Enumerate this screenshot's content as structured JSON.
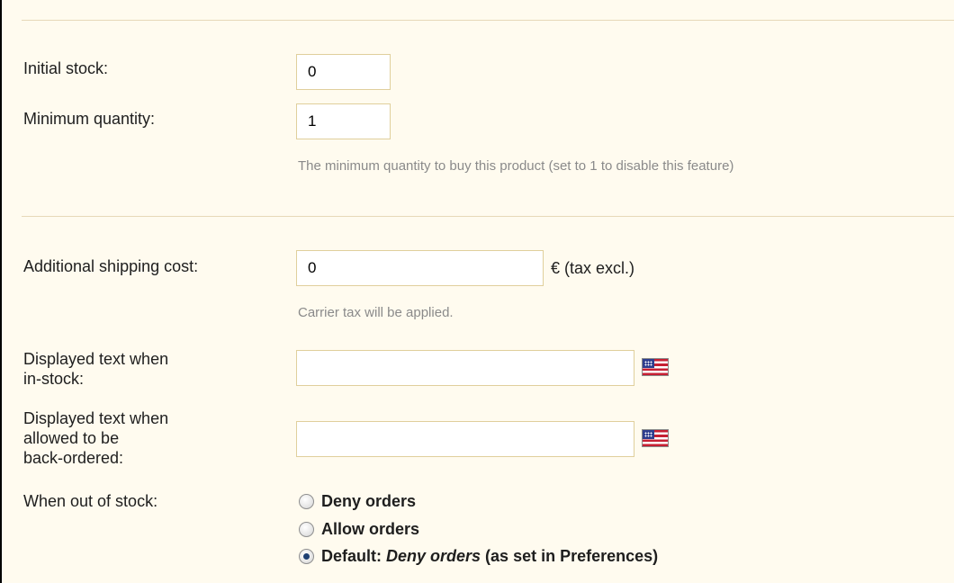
{
  "stock": {
    "initial_stock": {
      "label": "Initial stock:",
      "value": "0"
    },
    "minimum_quantity": {
      "label": "Minimum quantity:",
      "value": "1",
      "hint": "The minimum quantity to buy this product (set to 1 to disable this feature)"
    }
  },
  "shipping": {
    "label": "Additional shipping cost:",
    "value": "0",
    "suffix": "€ (tax excl.)",
    "hint": "Carrier tax will be applied."
  },
  "text_in_stock": {
    "label_line1": "Displayed text when",
    "label_line2": "in-stock:",
    "value": "",
    "flag_icon": "us-flag-icon"
  },
  "text_backorder": {
    "label_line1": "Displayed text when",
    "label_line2": "allowed to be",
    "label_line3": "back-ordered:",
    "value": "",
    "flag_icon": "us-flag-icon"
  },
  "out_of_stock": {
    "label": "When out of stock:",
    "options": [
      {
        "label": "Deny orders",
        "checked": false
      },
      {
        "label": "Allow orders",
        "checked": false
      },
      {
        "label_prefix": "Default: ",
        "label_italic": "Deny orders",
        "label_suffix": " (as set in Preferences)",
        "checked": true
      }
    ]
  },
  "colors": {
    "panel_background": "#fffbef",
    "input_border": "#e0cf9c",
    "divider": "#e7d8b8",
    "hint_text": "#8a8a8a"
  }
}
